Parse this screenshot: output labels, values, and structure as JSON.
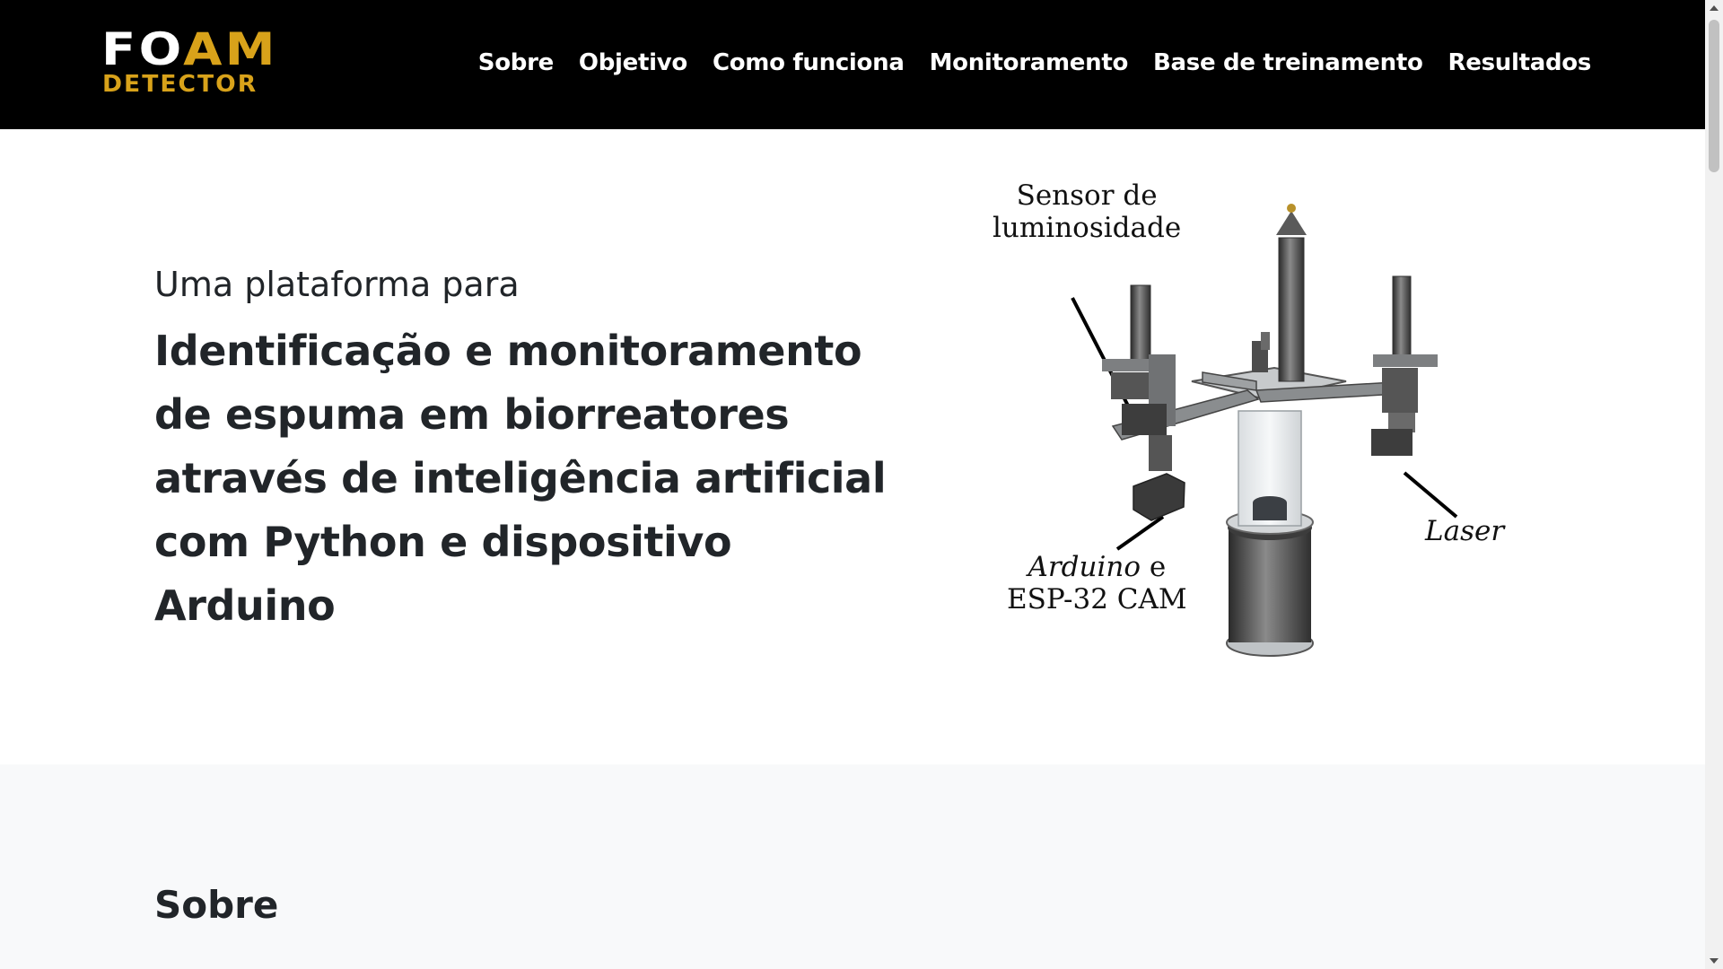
{
  "header": {
    "logo": {
      "line1_white": "FO",
      "line1_gold": "AM",
      "line2": "DETECTOR"
    },
    "nav": [
      {
        "label": "Sobre"
      },
      {
        "label": "Objetivo"
      },
      {
        "label": "Como funciona"
      },
      {
        "label": "Monitoramento"
      },
      {
        "label": "Base de treinamento"
      },
      {
        "label": "Resultados"
      }
    ]
  },
  "hero": {
    "subtitle": "Uma plataforma para",
    "title": "Identificação e monitoramento de espuma em biorreatores através de inteligência artificial com Python e dispositivo Arduino",
    "figure": {
      "label_sensor_1": "Sensor de",
      "label_sensor_2": "luminosidade",
      "label_laser": "Laser",
      "label_arduino_it": "Arduino",
      "label_arduino_e": " e",
      "label_esp": "ESP-32 CAM"
    }
  },
  "sections": [
    {
      "title": "Sobre"
    }
  ],
  "colors": {
    "navbar_bg": "#000000",
    "logo_gold": "#d8a21a",
    "text": "#212529",
    "section_bg": "#f8f9fa"
  }
}
